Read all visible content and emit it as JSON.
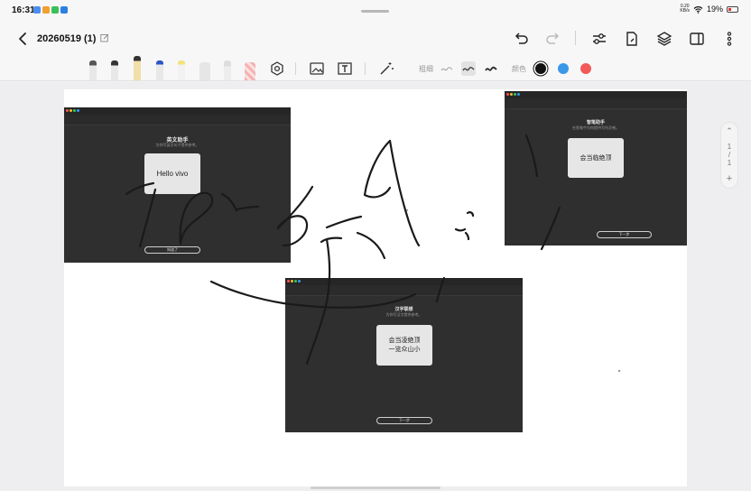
{
  "status_bar": {
    "time": "16:31",
    "net_speed": "0.20\nKB/s",
    "battery": "19%"
  },
  "document": {
    "title": "20260519 (1)"
  },
  "toolbar": {
    "thickness_label": "粗细",
    "color_label": "颜色",
    "colors": [
      "#111111",
      "#3b97e8",
      "#f25a5a"
    ]
  },
  "screens": [
    {
      "heading": "英文助手",
      "subtitle": "为你写英文句子提供参考。",
      "card_text": "Hello vivo",
      "button": "知道了"
    },
    {
      "heading": "智笔助手",
      "subtitle": "在智笔中为你提供写作灵感。",
      "card_text": "会当临绝顶",
      "button": "下一步"
    },
    {
      "heading": "汉字联想",
      "subtitle": "为你写汉字提供参考。",
      "card_line1": "会当凌绝顶",
      "card_line2": "一览众山小",
      "button": "下一步"
    }
  ],
  "pager": {
    "current": "1",
    "total": "1"
  },
  "icons": {
    "back": "chevron-left-icon",
    "edit": "edit-icon",
    "undo": "undo-icon",
    "redo": "redo-icon",
    "settings": "sliders-icon",
    "export": "export-icon",
    "layers": "layers-icon",
    "split": "split-view-icon",
    "more": "more-icon"
  }
}
